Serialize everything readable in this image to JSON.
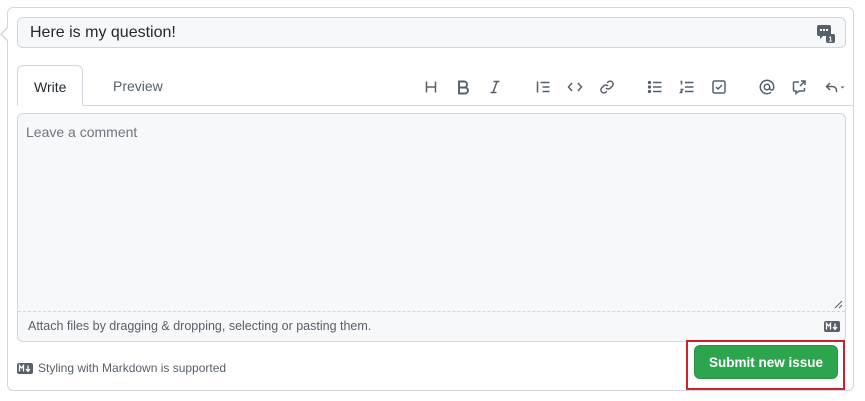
{
  "issue": {
    "title_value": "Here is my question!",
    "saved_replies_icon": "saved-replies-icon"
  },
  "tabs": [
    {
      "label": "Write",
      "selected": true
    },
    {
      "label": "Preview",
      "selected": false
    }
  ],
  "toolbar": {
    "buttons": [
      {
        "icon": "heading-icon"
      },
      {
        "icon": "bold-icon"
      },
      {
        "icon": "italic-icon"
      },
      {
        "icon": "quote-icon"
      },
      {
        "icon": "code-icon"
      },
      {
        "icon": "link-icon"
      },
      {
        "icon": "unordered-list-icon"
      },
      {
        "icon": "ordered-list-icon"
      },
      {
        "icon": "task-list-icon"
      },
      {
        "icon": "mention-icon"
      },
      {
        "icon": "cross-reference-icon"
      },
      {
        "icon": "reply-icon"
      }
    ]
  },
  "editor": {
    "placeholder": "Leave a comment",
    "value": "",
    "attach_text": "Attach files by dragging & dropping, selecting or pasting them."
  },
  "footer": {
    "markdown_note": "Styling with Markdown is supported",
    "submit_label": "Submit new issue"
  },
  "colors": {
    "submit_bg": "#2da44e",
    "highlight": "#d01f2d"
  }
}
